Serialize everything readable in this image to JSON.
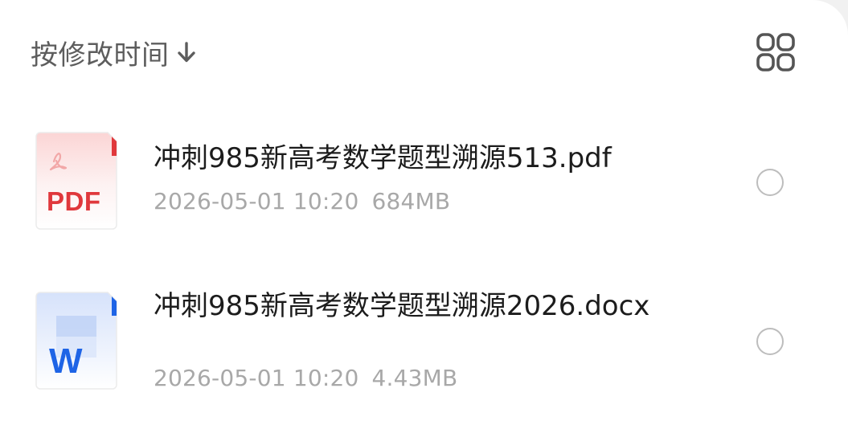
{
  "header": {
    "sort_label": "按修改时间",
    "sort_direction_icon": "arrow-down-icon",
    "view_toggle_icon": "grid-view-icon"
  },
  "files": [
    {
      "name": "冲刺985新高考数学题型溯源513.pdf",
      "modified": "2026-05-01 10:20",
      "size": "684MB",
      "type_badge": "PDF",
      "icon": "pdf-file-icon",
      "selected": false
    },
    {
      "name": "冲刺985新高考数学题型溯源2026.docx",
      "modified": "2026-05-01 10:20",
      "size": "4.43MB",
      "type_badge": "W",
      "icon": "word-file-icon",
      "selected": false
    }
  ],
  "colors": {
    "pdf_accent": "#e0383c",
    "word_accent": "#1e64e6",
    "title_text": "#1c1c1c",
    "meta_text": "#a8a8a8",
    "sort_text": "#5d5d5d"
  }
}
